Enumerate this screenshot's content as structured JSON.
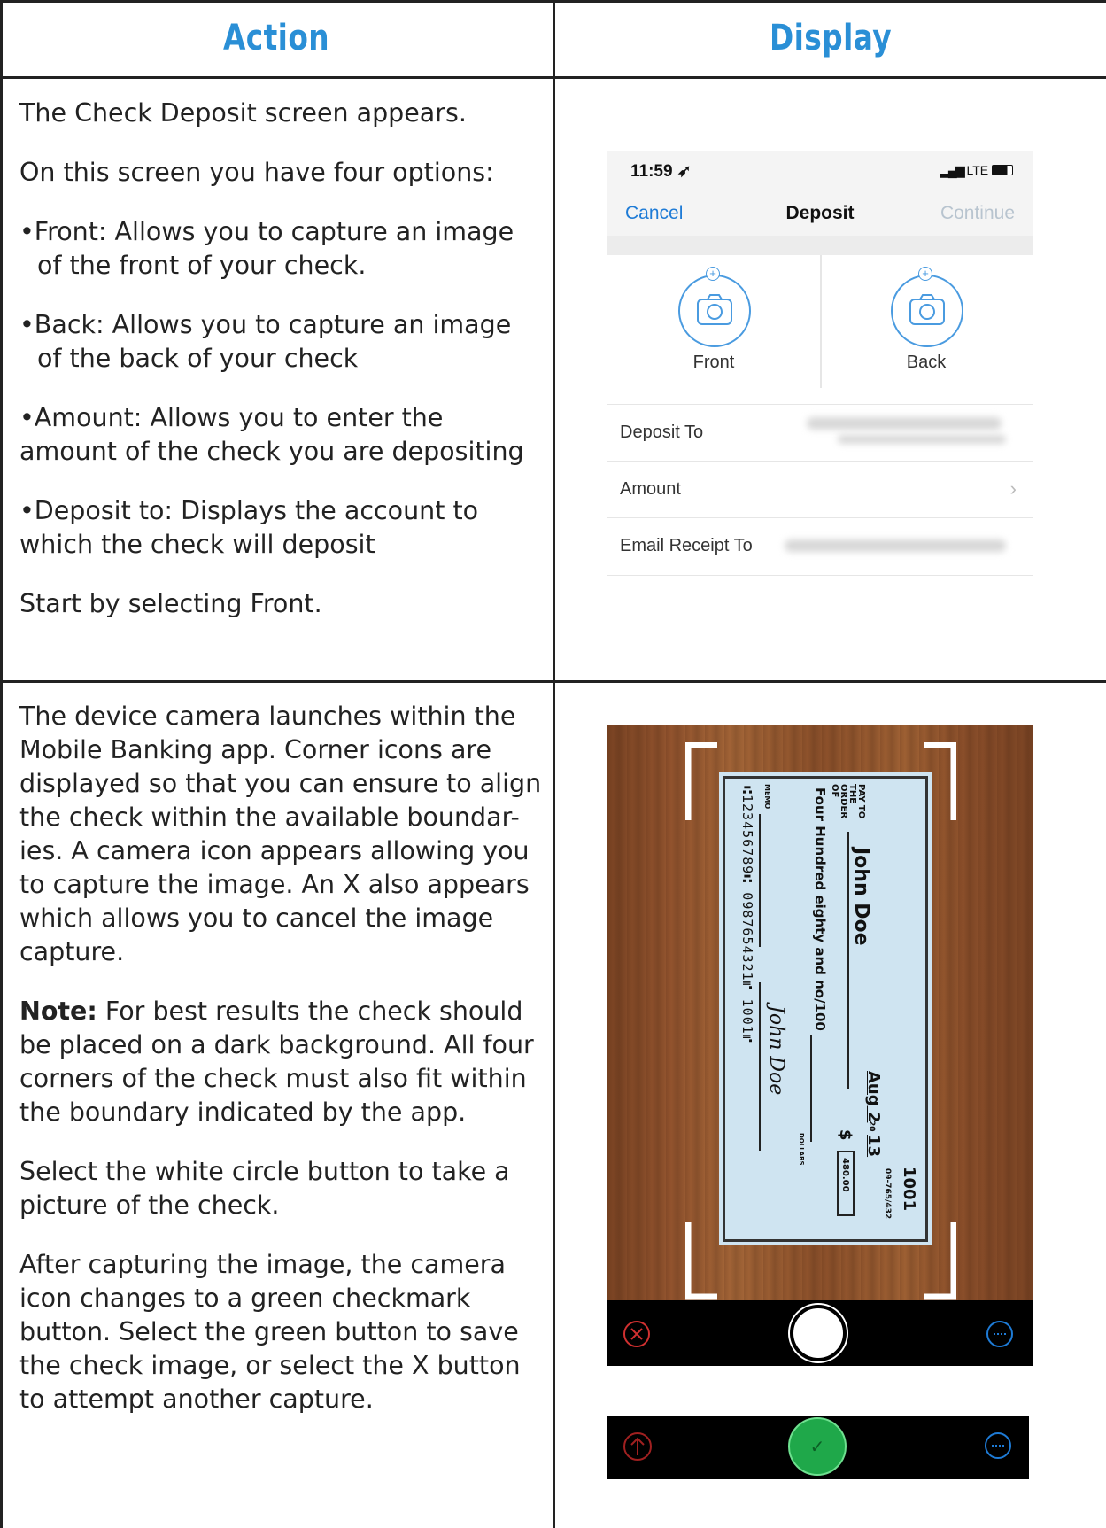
{
  "header": {
    "action": "Action",
    "display": "Display"
  },
  "row1": {
    "p1": "The Check Deposit screen appears.",
    "p2": "On this screen you have four options:",
    "b1": "•Front: Allows you to capture an image of the front of your check.",
    "b2": "•Back: Allows you to capture an image of the back of your check",
    "b3": "•Amount: Allows you to enter the amount of the check you are depositing",
    "b4": "•Deposit to: Displays the account to which the check will deposit",
    "p3": "Start by selecting Front."
  },
  "phone": {
    "time": "11:59",
    "signal": "LTE",
    "cancel": "Cancel",
    "title": "Deposit",
    "continue": "Continue",
    "front": "Front",
    "back": "Back",
    "deposit_to": "Deposit To",
    "amount": "Amount",
    "email_receipt": "Email Receipt To"
  },
  "row2": {
    "p1": "The device camera launches within the Mobile Banking app. Corner icons are displayed so that you can ensure to align the check within the available boundar-ies. A camera icon appears allowing you to capture the image. An X also appears which allows you to cancel the image capture.",
    "note_label": "Note:",
    "note_text": " For best results the check should be placed on a dark background. All four corners of the check must also fit within the boundary indicated by the app.",
    "p3": "Select the white circle button to take a picture of the check.",
    "p4": "After capturing the image, the camera icon changes to a green checkmark button.  Select the green button to save the check image, or select the X button to attempt another capture."
  },
  "check": {
    "pay_to": "PAY TO THE ORDER OF",
    "payee": "John Doe",
    "date": "Aug 2",
    "year_prefix": "20",
    "year": "13",
    "number": "1001",
    "routing_small": "09-765/432",
    "dollar_sign": "$",
    "amount": "480.00",
    "written_amount": "Four Hundred eighty and no/100",
    "dollars": "DOLLARS",
    "memo": "MEMO",
    "signature": "John Doe",
    "micr": "⑆123456789⑆  0987654321⑈  1001⑈"
  },
  "colors": {
    "accent": "#2a8fd6",
    "ios_blue": "#1e7bd6",
    "cancel_red": "#d03030",
    "confirm_green": "#1fa84a"
  }
}
